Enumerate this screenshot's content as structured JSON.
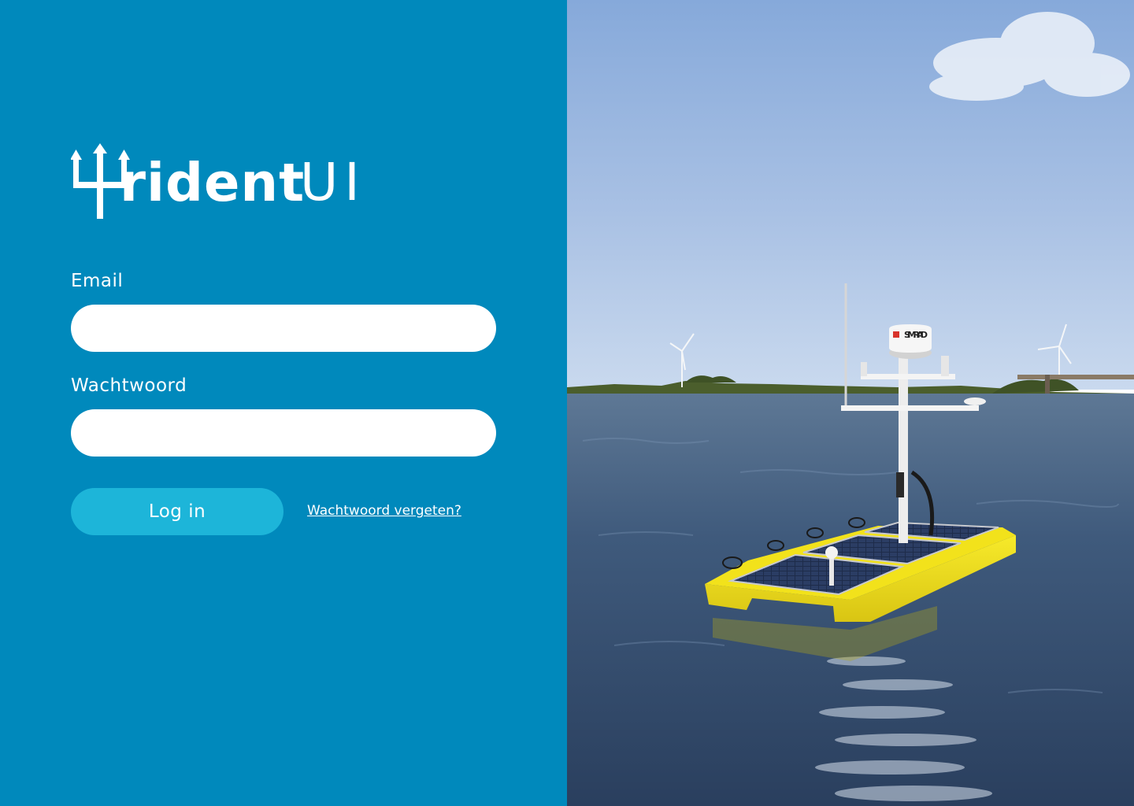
{
  "brand": {
    "name_word": "rident",
    "name_suffix": "UI",
    "full_name": "Trident UI"
  },
  "form": {
    "email_label": "Email",
    "email_value": "",
    "password_label": "Wachtwoord",
    "password_value": "",
    "login_button_label": "Log in",
    "forgot_password_link": "Wachtwoord vergeten?"
  },
  "photo": {
    "radome_text": "SIMRAD"
  },
  "colors": {
    "panel_background": "#0089BC",
    "button_background": "#1DB5D9",
    "input_background": "#FFFFFF",
    "vessel_hull": "#F2E21B"
  },
  "icons": {
    "logo_mark": "trident-icon"
  }
}
